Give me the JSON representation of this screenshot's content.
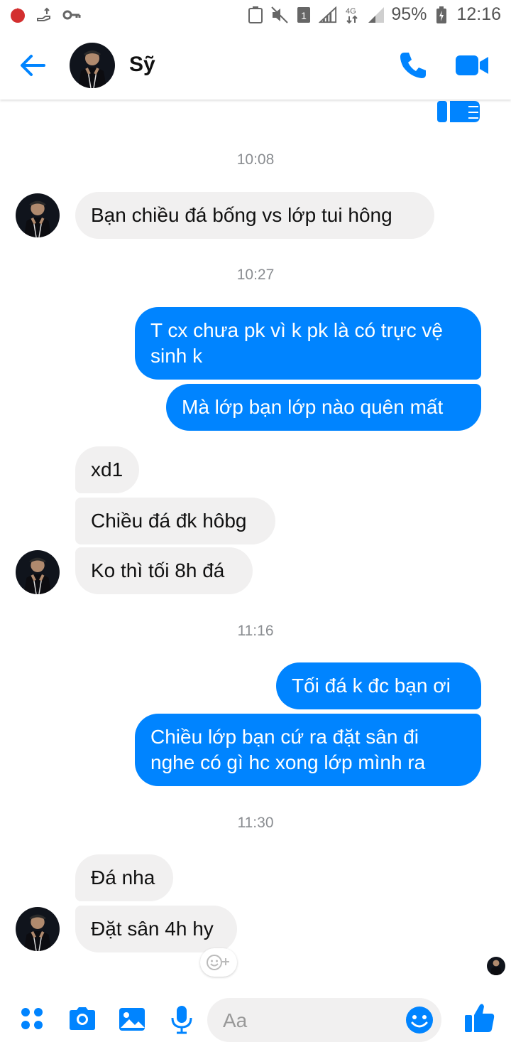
{
  "status_bar": {
    "battery": "95%",
    "time": "12:16",
    "network": "4G"
  },
  "header": {
    "contact_name": "Sỹ"
  },
  "messages": [
    {
      "type": "timestamp",
      "text": "10:08"
    },
    {
      "type": "incoming",
      "text": "Bạn chiều đá bống vs lớp tui hông"
    },
    {
      "type": "timestamp",
      "text": "10:27"
    },
    {
      "type": "outgoing",
      "text": "T cx chưa pk vì k pk là có trực vệ sinh k"
    },
    {
      "type": "outgoing",
      "text": "Mà lớp bạn lớp nào quên mất"
    },
    {
      "type": "incoming",
      "text": "xd1"
    },
    {
      "type": "incoming",
      "text": "Chiều đá đk hôbg"
    },
    {
      "type": "incoming",
      "text": "Ko thì tối 8h đá"
    },
    {
      "type": "timestamp",
      "text": "11:16"
    },
    {
      "type": "outgoing",
      "text": "Tối đá k đc bạn ơi"
    },
    {
      "type": "outgoing",
      "text": "Chiều lớp bạn cứ ra đặt sân đi nghe có gì hc xong lớp mình ra"
    },
    {
      "type": "timestamp",
      "text": "11:30"
    },
    {
      "type": "incoming",
      "text": "Đá nha"
    },
    {
      "type": "incoming",
      "text": "Đặt sân 4h hy"
    }
  ],
  "composer": {
    "placeholder": "Aa"
  },
  "colors": {
    "accent": "#0084ff",
    "incoming_bubble": "#f1f0f0",
    "timestamp": "#8a8d91"
  }
}
